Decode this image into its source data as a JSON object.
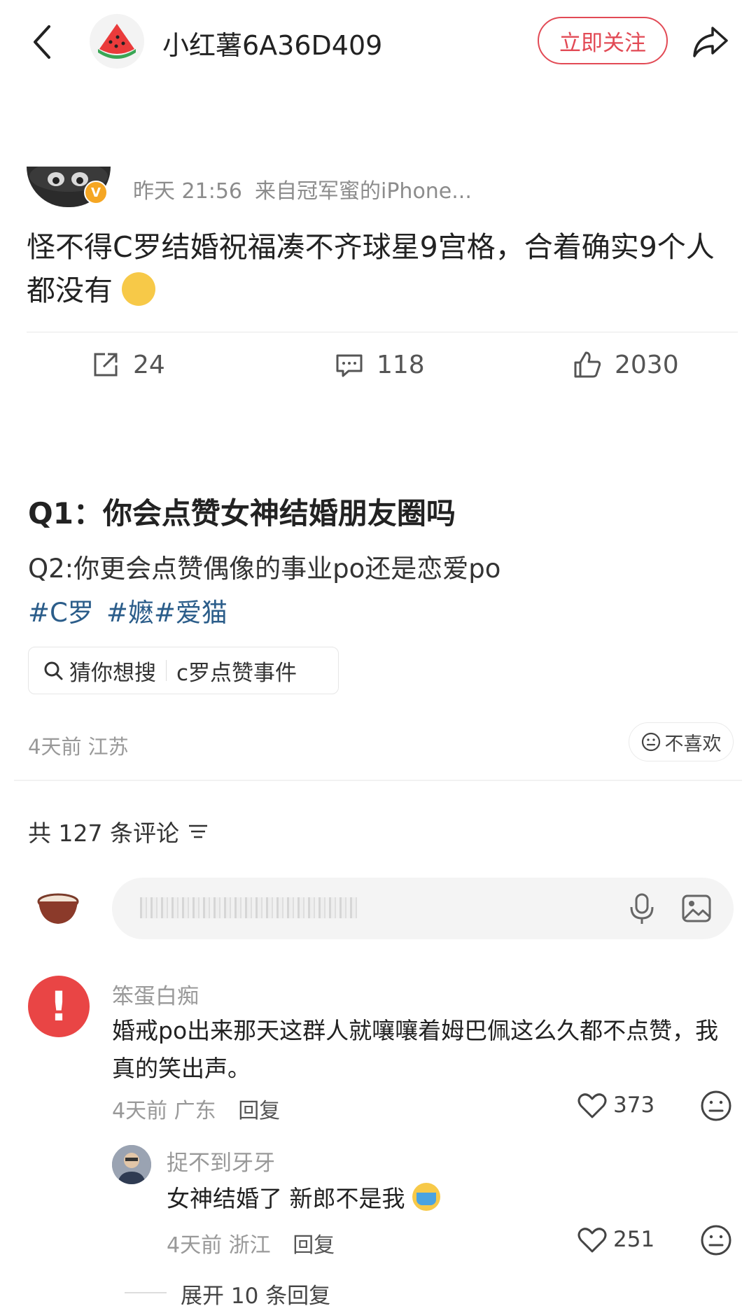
{
  "header": {
    "title": "小红薯6A36D409",
    "follow_label": "立即关注"
  },
  "embedded_post": {
    "badge": "V",
    "time": "昨天 21:56",
    "source": "来自冠军蜜的iPhone...",
    "text": "怪不得C罗结婚祝福凑不齐球星9宫格，合着确实9个人都没有",
    "stats": {
      "reposts": "24",
      "comments": "118",
      "likes": "2030"
    }
  },
  "post": {
    "title": "Q1：你会点赞女神结婚朋友圈吗",
    "body": "Q2:你更会点赞偶像的事业po还是恋爱po",
    "tags": [
      "#C罗",
      "#嬷#爱猫"
    ],
    "guess_label": "猜你想搜",
    "guess_query": "c罗点赞事件",
    "date": "4天前",
    "location": "江苏",
    "dislike_label": "不喜欢"
  },
  "comments_section": {
    "count_label": "共 127 条评论"
  },
  "comments": [
    {
      "avatar_text": "!",
      "name": "笨蛋白痴",
      "text": "婚戒po出来那天这群人就嚷嚷着姆巴佩这么久都不点赞，我真的笑出声。",
      "date": "4天前",
      "location": "广东",
      "reply_label": "回复",
      "likes": "373"
    },
    {
      "name": "捉不到牙牙",
      "text": "女神结婚了 新郎不是我",
      "date": "4天前",
      "location": "浙江",
      "reply_label": "回复",
      "likes": "251"
    }
  ],
  "expand_label": "展开 10 条回复",
  "colors": {
    "accent_red": "#e24a55",
    "tag_blue": "#2b5d8a",
    "vip_badge": "#f5a623"
  }
}
